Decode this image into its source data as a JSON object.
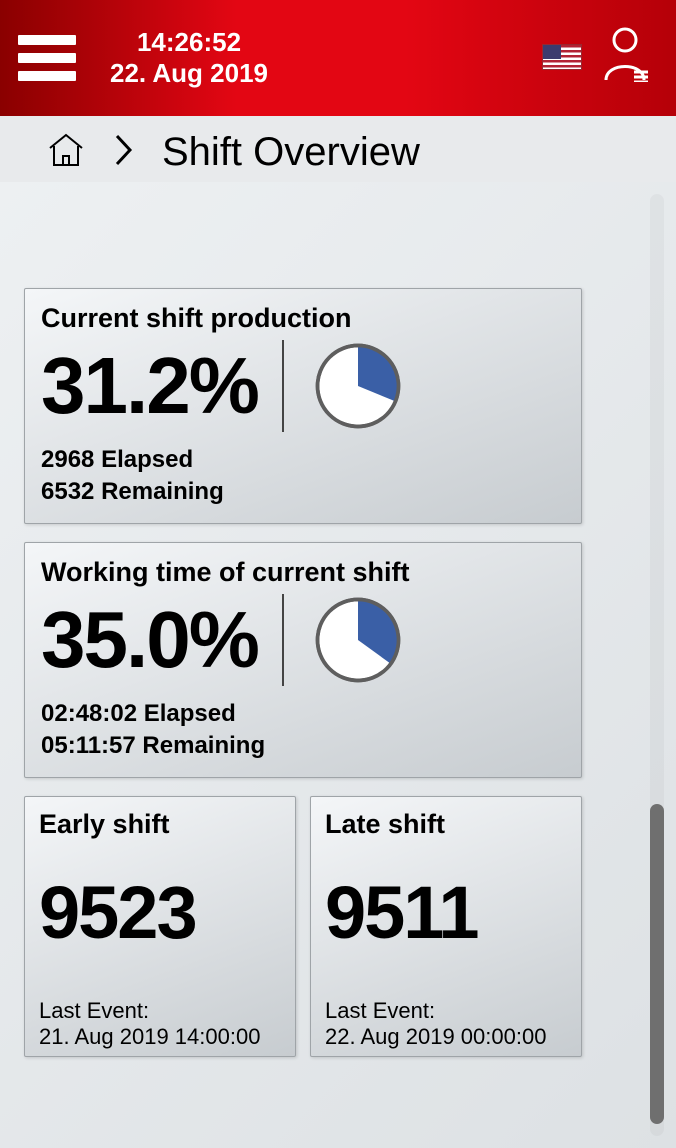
{
  "header": {
    "time": "14:26:52",
    "date": "22. Aug 2019"
  },
  "breadcrumb": {
    "title": "Shift Overview"
  },
  "cards": {
    "production": {
      "title": "Current shift production",
      "percent": "31.2%",
      "pie_fraction": 0.312,
      "elapsed_value": "2968",
      "elapsed_label": "Elapsed",
      "remaining_value": "6532",
      "remaining_label": "Remaining"
    },
    "working_time": {
      "title": "Working time of current shift",
      "percent": "35.0%",
      "pie_fraction": 0.35,
      "elapsed_value": "02:48:02",
      "elapsed_label": "Elapsed",
      "remaining_value": "05:11:57",
      "remaining_label": "Remaining"
    },
    "early": {
      "title": "Early shift",
      "value": "9523",
      "last_event_label": "Last Event:",
      "last_event_value": "21. Aug 2019 14:00:00"
    },
    "late": {
      "title": "Late shift",
      "value": "9511",
      "last_event_label": "Last Event:",
      "last_event_value": "22. Aug 2019 00:00:00"
    }
  },
  "colors": {
    "pie_fill": "#3a5fa6",
    "pie_bg": "#ffffff",
    "pie_stroke": "#5e5e5e"
  },
  "chart_data": [
    {
      "type": "pie",
      "title": "Current shift production",
      "series": [
        {
          "name": "Elapsed",
          "value": 2968
        },
        {
          "name": "Remaining",
          "value": 6532
        }
      ],
      "percent": 31.2
    },
    {
      "type": "pie",
      "title": "Working time of current shift",
      "series": [
        {
          "name": "Elapsed (hh:mm:ss)",
          "value": "02:48:02"
        },
        {
          "name": "Remaining (hh:mm:ss)",
          "value": "05:11:57"
        }
      ],
      "percent": 35.0
    }
  ]
}
